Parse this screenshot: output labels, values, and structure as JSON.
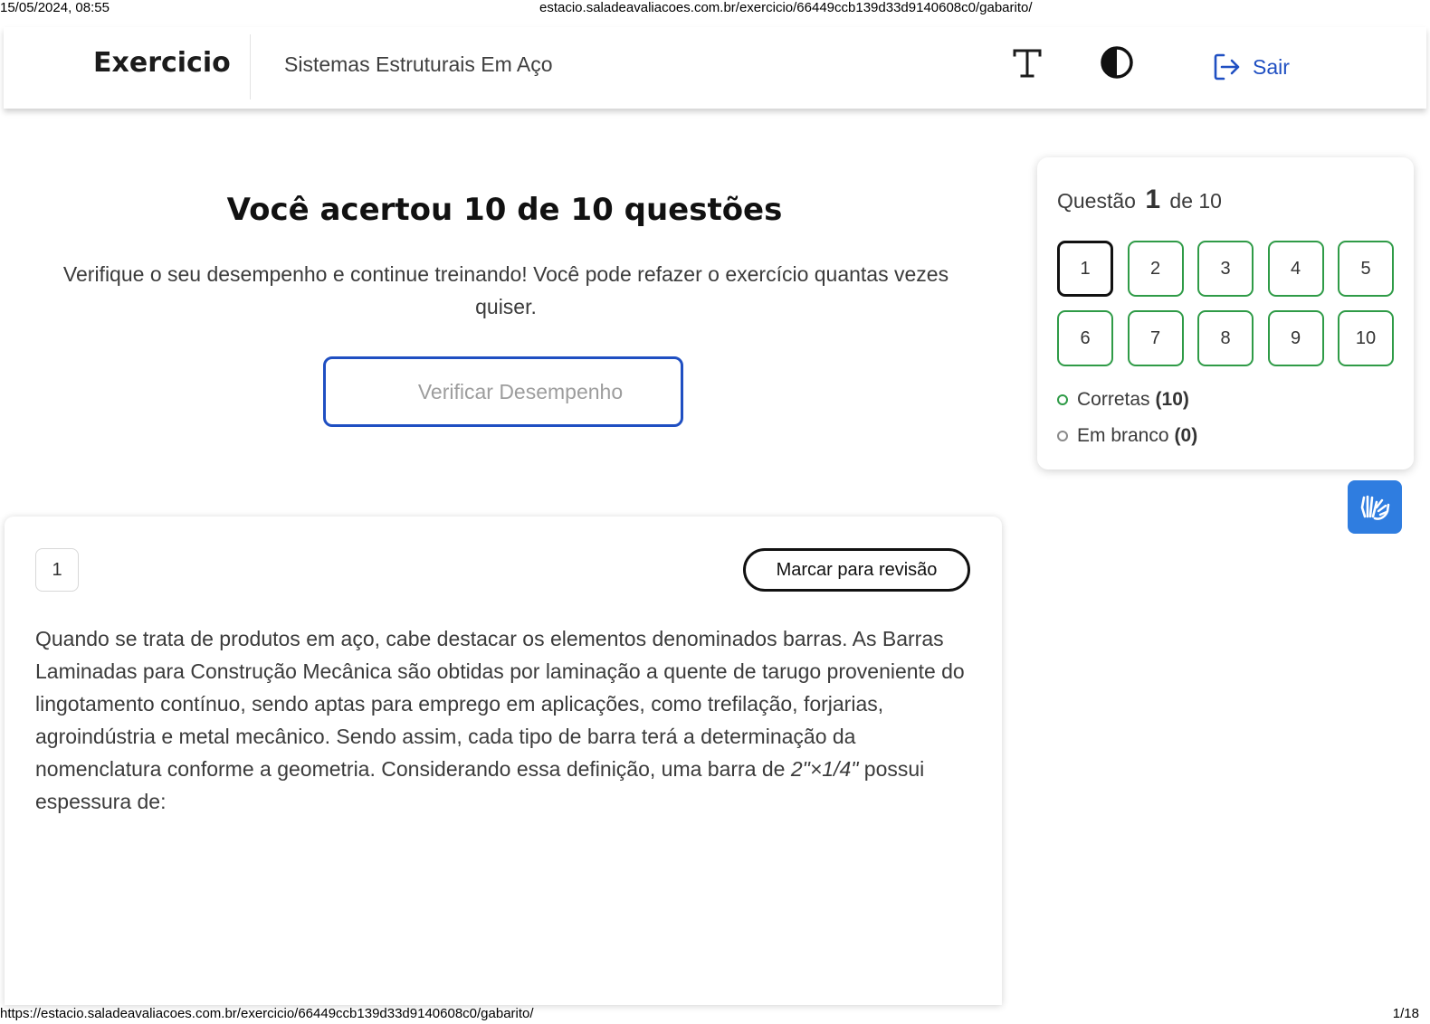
{
  "print": {
    "date": "15/05/2024, 08:55",
    "title": "estacio.saladeavaliacoes.com.br/exercicio/66449ccb139d33d9140608c0/gabarito/",
    "url": "https://estacio.saladeavaliacoes.com.br/exercicio/66449ccb139d33d9140608c0/gabarito/",
    "page": "1/18"
  },
  "header": {
    "brand": "Exercicio",
    "subject": "Sistemas Estruturais Em Aço",
    "logout_label": "Sair",
    "icons": [
      "font-size-icon",
      "contrast-icon",
      "logout-icon"
    ],
    "accent_color": "#1f4fc2"
  },
  "result": {
    "title": "Você acertou 10 de 10 questões",
    "description": "Verifique o seu desempenho e continue treinando! Você pode refazer o exercício quantas vezes quiser.",
    "verify_button": "Verificar Desempenho"
  },
  "navigator": {
    "label_prefix": "Questão",
    "current": "1",
    "label_suffix": "de 10",
    "questions": [
      "1",
      "2",
      "3",
      "4",
      "5",
      "6",
      "7",
      "8",
      "9",
      "10"
    ],
    "correct_label": "Corretas",
    "correct_count": "(10)",
    "blank_label": "Em branco",
    "blank_count": "(0)",
    "correct_color": "#2f9b47",
    "blank_color": "#8a8a8a"
  },
  "question": {
    "number": "1",
    "review_button": "Marcar para revisão",
    "text_before": "Quando se trata de produtos em aço, cabe destacar os elementos denominados barras. As Barras Laminadas para Construção Mecânica são obtidas por laminação a quente de tarugo proveniente do lingotamento contínuo, sendo aptas para emprego em aplicações, como trefilação, forjarias, agroindústria e metal mecânico. Sendo assim, cada tipo de barra terá a determinação da nomenclatura conforme a geometria. Considerando essa definição, uma barra de ",
    "formula": "2\"×1/4\"",
    "text_after": " possui espessura de:"
  },
  "accessibility": {
    "vlibras_icon": "sign-language-hands-icon"
  }
}
